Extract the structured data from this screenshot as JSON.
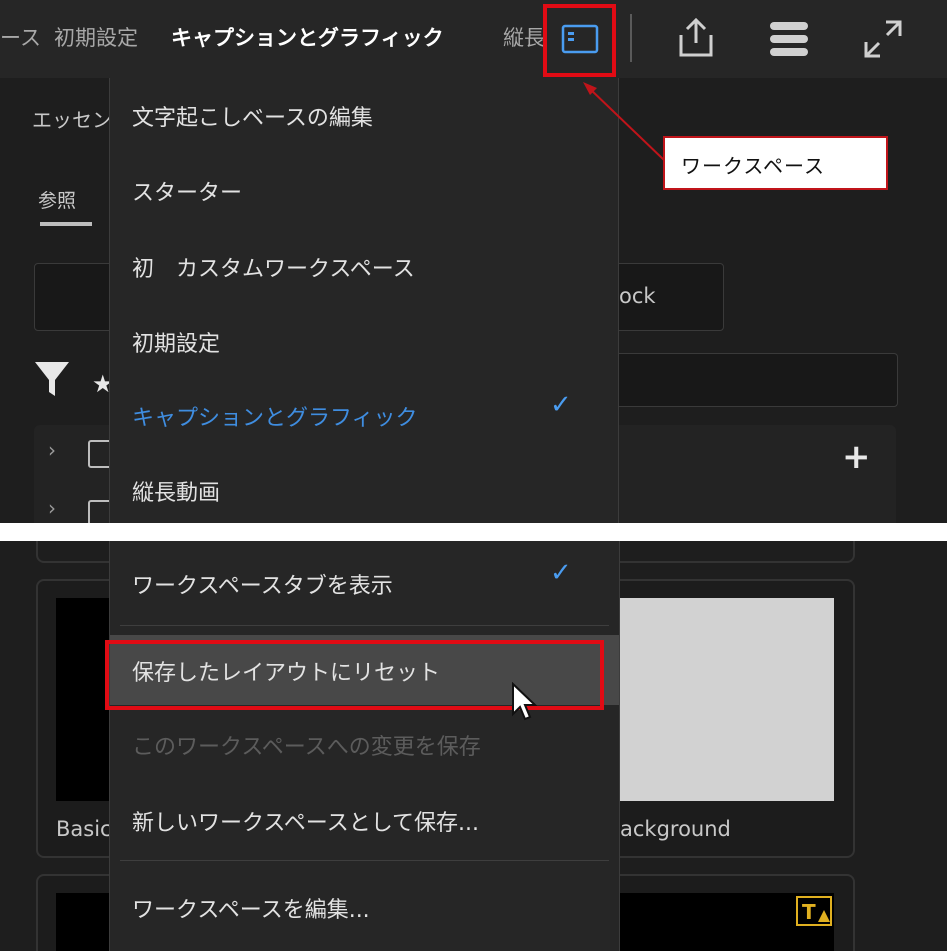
{
  "header": {
    "tabs": [
      {
        "label": "ース",
        "active": false
      },
      {
        "label": "初期設定",
        "active": false
      },
      {
        "label": "キャプションとグラフィック",
        "active": true
      },
      {
        "label": "縦長",
        "active": false
      }
    ],
    "icons": [
      "workspace-panel-icon",
      "share-export-icon",
      "stacked-layers-icon",
      "fullscreen-icon"
    ]
  },
  "background": {
    "panel_title_partial": "エッセン",
    "tab_browse": "参照",
    "search_text_partial": "ock",
    "thumb_label_left": "Basic",
    "thumb_label_right": "ackground"
  },
  "callout": {
    "label": "ワークスペース"
  },
  "menu_top": {
    "items": [
      {
        "label": "文字起こしベースの編集"
      },
      {
        "label": "スターター"
      },
      {
        "label": "初　カスタムワークスペース"
      },
      {
        "label": "初期設定"
      },
      {
        "label": "キャプションとグラフィック",
        "selected": true
      },
      {
        "label": "縦長動画"
      }
    ]
  },
  "menu_bottom": {
    "items": [
      {
        "label": "ワークスペースタブを表示",
        "checked": true
      },
      {
        "label": "保存したレイアウトにリセット",
        "highlighted": true
      },
      {
        "label": "このワークスペースへの変更を保存",
        "disabled": true
      },
      {
        "label": "新しいワークスペースとして保存..."
      },
      {
        "label": "ワークスペースを編集..."
      }
    ]
  },
  "colors": {
    "accent": "#3f8de0",
    "annotation_red": "#e10b14",
    "menu_bg": "#262626",
    "panel_bg": "#1e1e1e"
  }
}
